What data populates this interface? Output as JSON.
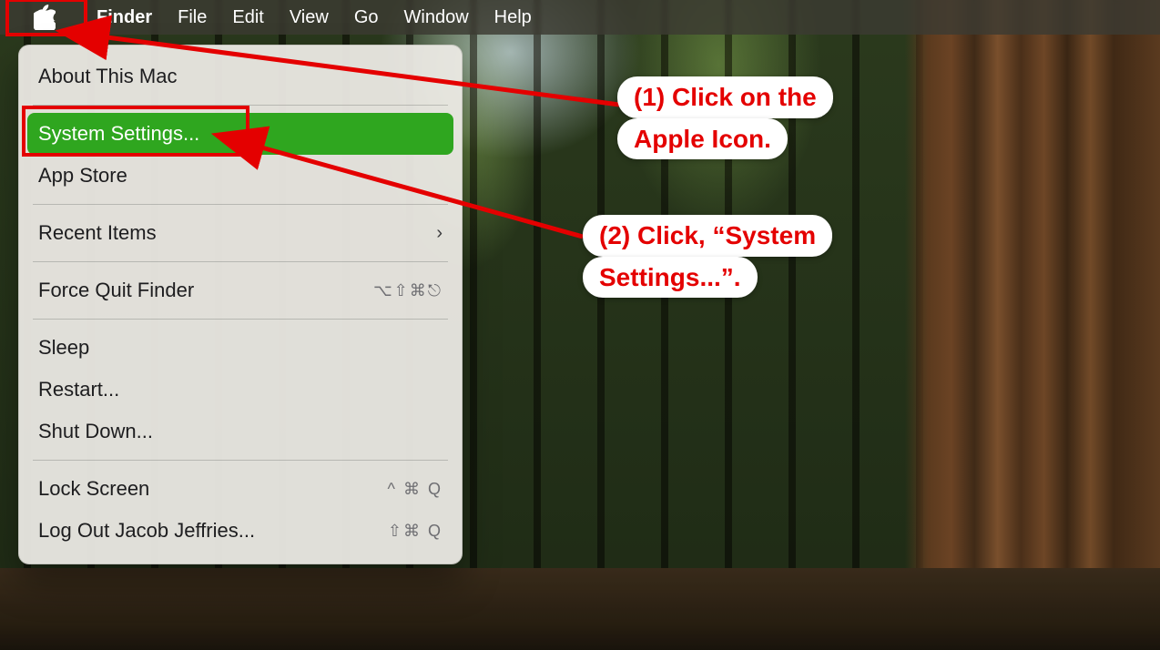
{
  "menubar": {
    "app": "Finder",
    "items": [
      "File",
      "Edit",
      "View",
      "Go",
      "Window",
      "Help"
    ]
  },
  "apple_menu": {
    "about": "About This Mac",
    "system_settings": "System Settings...",
    "app_store": "App Store",
    "recent_items": "Recent Items",
    "force_quit": "Force Quit Finder",
    "force_quit_shortcut": "⌥⇧⌘⎋",
    "sleep": "Sleep",
    "restart": "Restart...",
    "shut_down": "Shut Down...",
    "lock_screen": "Lock Screen",
    "lock_screen_shortcut": "^ ⌘ Q",
    "log_out": "Log Out Jacob Jeffries...",
    "log_out_shortcut": "⇧⌘ Q"
  },
  "callouts": {
    "one_line1": "(1) Click on the",
    "one_line2": "Apple Icon.",
    "two_line1": "(2) Click, “System",
    "two_line2": "Settings...”."
  }
}
